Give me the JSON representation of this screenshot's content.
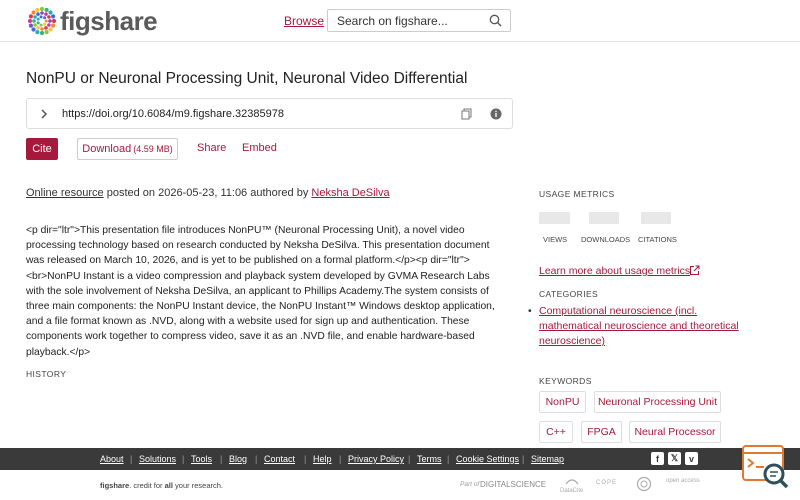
{
  "header": {
    "logo_text": "figshare",
    "browse_label": "Browse",
    "search_placeholder": "Search on figshare..."
  },
  "item": {
    "title": "NonPU or Neuronal Processing Unit, Neuronal Video Differential",
    "doi": "https://doi.org/10.6084/m9.figshare.32385978",
    "cite_label": "Cite",
    "download_label": "Download",
    "download_size": "(4.59 MB)",
    "share_label": "Share",
    "embed_label": "Embed",
    "type_label": "Online resource",
    "posted_text": " posted on 2026-05-23, 11:06 authored by ",
    "author": "Neksha DeSilva",
    "description": "<p dir=\"ltr\">This presentation file introduces NonPU™ (Neuronal Processing Unit), a novel video processing technology based on research conducted by Neksha DeSilva. This presentation document was released on March 10, 2026, and is yet to be published on a formal platform.</p><p dir=\"ltr\"><br>NonPU Instant is a video compression and playback system developed by GVMA Research Labs with the sole involvement of Neksha DeSilva, an applicant to Phillips Academy.The system consists of three main components: the NonPU Instant device, the NonPU Instant™ Windows desktop application, and a file format known as .NVD, along with a website used for sign up and authentication. These components work together to compress video, save it as an .NVD file, and enable hardware-based playback.</p>",
    "history_heading": "HISTORY"
  },
  "sidebar": {
    "usage_heading": "USAGE METRICS",
    "metrics": [
      {
        "label": "VIEWS"
      },
      {
        "label": "DOWNLOADS"
      },
      {
        "label": "CITATIONS"
      }
    ],
    "metrics_link": "Learn more about usage metrics",
    "categories_heading": "CATEGORIES",
    "category": "Computational neuroscience (incl. mathematical neuroscience and theoretical neuroscience)",
    "keywords_heading": "KEYWORDS",
    "keywords": [
      "NonPU",
      "Neuronal Processing Unit",
      "C++",
      "FPGA",
      "Neural Processor"
    ]
  },
  "footer": {
    "links": [
      "About",
      "Solutions",
      "Tools",
      "Blog",
      "Contact",
      "Help",
      "Privacy Policy",
      "Terms",
      "Cookie Settings",
      "Sitemap"
    ],
    "credit_brand": "figshare",
    "credit_mid": ". credit for ",
    "credit_all": "all",
    "credit_end": " your research.",
    "part_of": "Part of",
    "digital_science": "DIGITALSCIENCE",
    "partner_logos": [
      "DataCite",
      "COPE",
      "",
      "open access"
    ]
  },
  "colors": {
    "brand": "#a6193c",
    "footer_bg": "#3a3a3a"
  }
}
